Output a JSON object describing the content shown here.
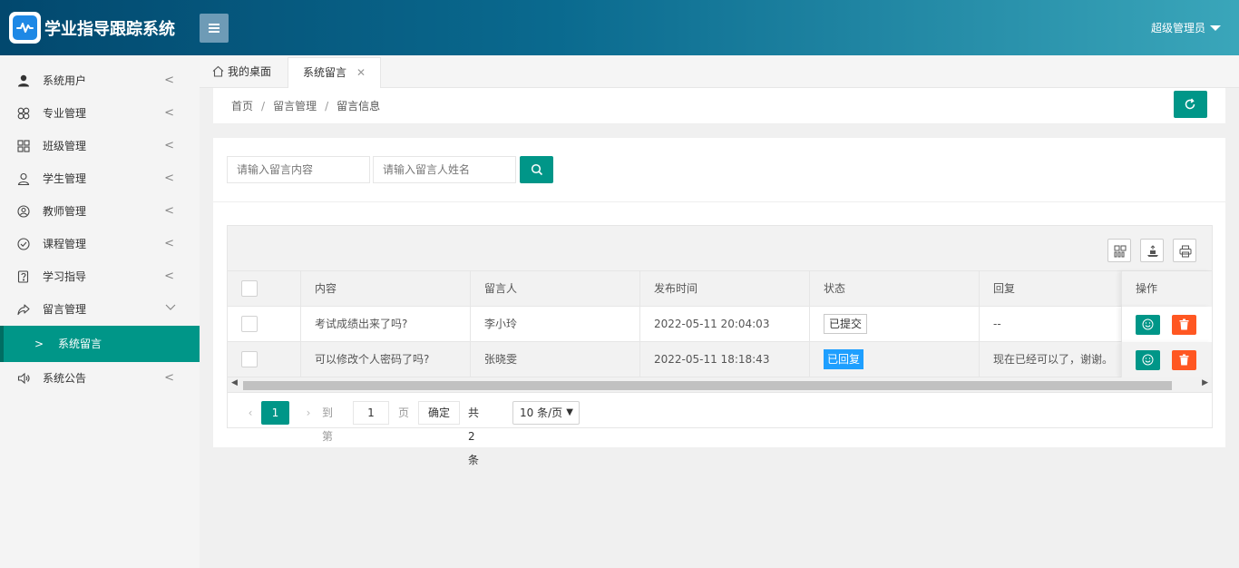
{
  "app": {
    "title": "学业指导跟踪系统"
  },
  "header": {
    "user": "超级管理员"
  },
  "sidebar": {
    "items": [
      {
        "label": "系统用户",
        "icon": "user-icon"
      },
      {
        "label": "专业管理",
        "icon": "clover-icon"
      },
      {
        "label": "班级管理",
        "icon": "grid-icon"
      },
      {
        "label": "学生管理",
        "icon": "student-icon"
      },
      {
        "label": "教师管理",
        "icon": "teacher-icon"
      },
      {
        "label": "课程管理",
        "icon": "check-circle-icon"
      },
      {
        "label": "学习指导",
        "icon": "help-doc-icon"
      },
      {
        "label": "留言管理",
        "icon": "share-icon"
      },
      {
        "label": "系统公告",
        "icon": "speaker-icon"
      }
    ],
    "sub_item": "系统留言"
  },
  "tabs": {
    "home": "我的桌面",
    "active": "系统留言"
  },
  "breadcrumb": {
    "items": [
      "首页",
      "留言管理",
      "留言信息"
    ]
  },
  "search": {
    "content_placeholder": "请输入留言内容",
    "name_placeholder": "请输入留言人姓名"
  },
  "table": {
    "columns": [
      "内容",
      "留言人",
      "发布时间",
      "状态",
      "回复",
      "操作"
    ],
    "rows": [
      {
        "content": "考试成绩出来了吗?",
        "author": "李小玲",
        "time": "2022-05-11 20:04:03",
        "status": "已提交",
        "reply": "--"
      },
      {
        "content": "可以修改个人密码了吗?",
        "author": "张晓雯",
        "time": "2022-05-11 18:18:43",
        "status": "已回复",
        "reply": "现在已经可以了，谢谢。"
      }
    ]
  },
  "pager": {
    "prev": "‹",
    "current": "1",
    "next": "›",
    "goto_label": "到第",
    "input_value": "1",
    "page_label": "页",
    "confirm": "确定",
    "total": "共 2 条",
    "page_size": "10 条/页"
  },
  "colors": {
    "primary": "#009688",
    "danger": "#ff5722",
    "info": "#1e9fff"
  }
}
